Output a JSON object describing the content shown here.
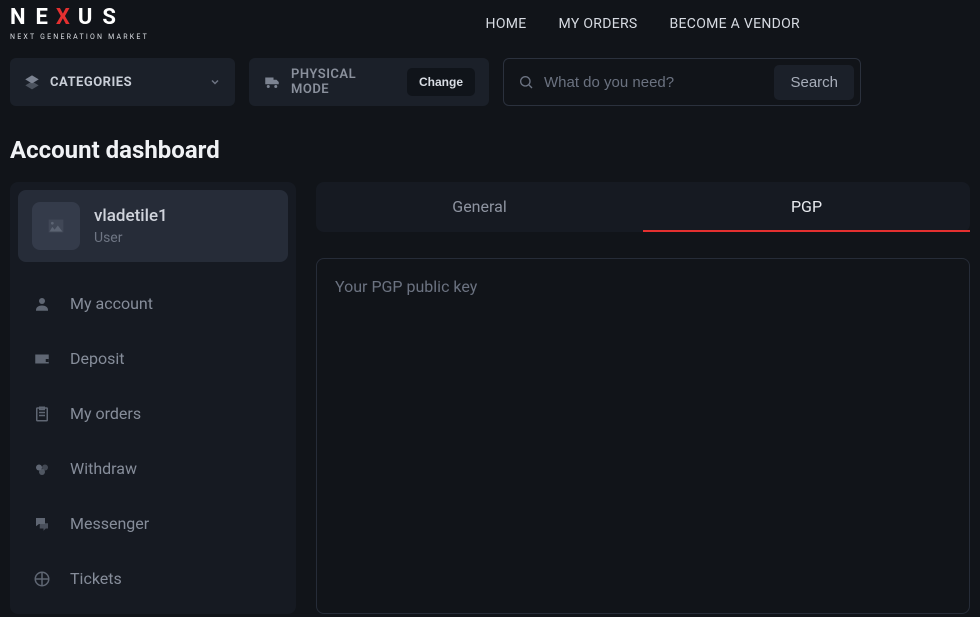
{
  "brand": {
    "name_pre": "NE",
    "name_mid": "X",
    "name_post": "US",
    "tagline": "NEXT GENERATION MARKET",
    "accent": "#e43030"
  },
  "topnav": {
    "home": "HOME",
    "my_orders": "MY ORDERS",
    "become_vendor": "BECOME A VENDOR"
  },
  "controls": {
    "categories_label": "CATEGORIES",
    "mode_label": "PHYSICAL MODE",
    "change_label": "Change",
    "search_placeholder": "What do you need?",
    "search_button": "Search"
  },
  "page_title": "Account dashboard",
  "user": {
    "name": "vladetile1",
    "role": "User"
  },
  "sidebar": {
    "items": [
      {
        "icon": "user-icon",
        "label": "My account"
      },
      {
        "icon": "wallet-icon",
        "label": "Deposit"
      },
      {
        "icon": "clipboard-icon",
        "label": "My orders"
      },
      {
        "icon": "withdraw-icon",
        "label": "Withdraw"
      },
      {
        "icon": "chat-icon",
        "label": "Messenger"
      },
      {
        "icon": "ticket-icon",
        "label": "Tickets"
      }
    ]
  },
  "tabs": {
    "general": "General",
    "pgp": "PGP"
  },
  "pgp_panel": {
    "placeholder": "Your PGP public key",
    "value": ""
  }
}
